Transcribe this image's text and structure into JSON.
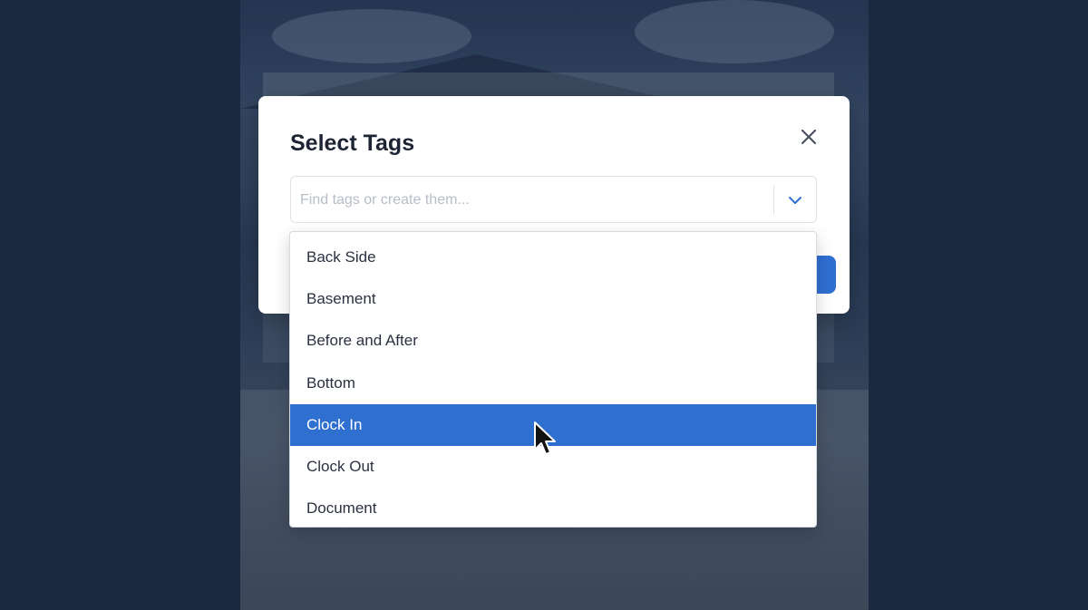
{
  "modal": {
    "title": "Select Tags",
    "search_placeholder": "Find tags or create them...",
    "search_value": ""
  },
  "dropdown": {
    "options": [
      {
        "label": "Back Side"
      },
      {
        "label": "Basement"
      },
      {
        "label": "Before and After"
      },
      {
        "label": "Bottom"
      },
      {
        "label": "Clock In"
      },
      {
        "label": "Clock Out"
      },
      {
        "label": "Document"
      }
    ],
    "highlighted_option": "Clock In"
  },
  "icons": {
    "close": "close-icon",
    "toggle": "chevron-down-icon",
    "cursor": "mouse-pointer-icon"
  },
  "colors": {
    "accent": "#2f6fd0",
    "title_text": "#1d2433",
    "background": "#1b2a41"
  }
}
